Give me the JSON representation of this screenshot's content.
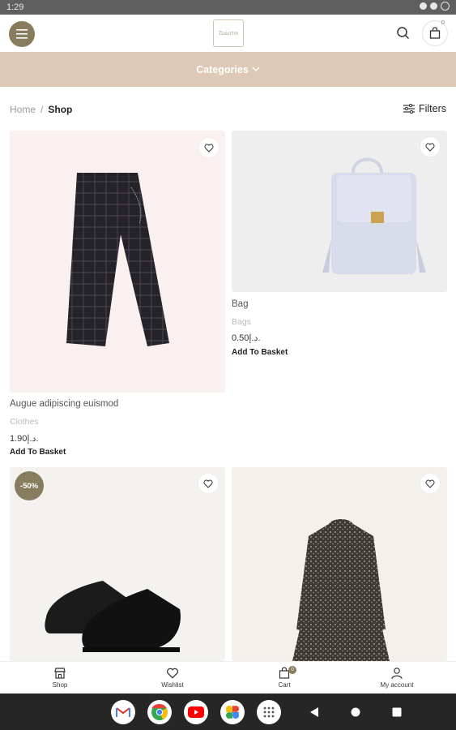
{
  "status_bar": {
    "time": "1:29"
  },
  "header": {
    "logo_text": "Tasarim",
    "cart_count": "0"
  },
  "categories": {
    "label": "Categories"
  },
  "breadcrumb": {
    "home": "Home",
    "separator": "/",
    "current": "Shop"
  },
  "filters": {
    "label": "Filters"
  },
  "products": [
    {
      "name": "Augue adipiscing euismod",
      "category": "Clothes",
      "price": "1.90د.إ.",
      "action": "Add To Basket",
      "image": "checkered-trousers",
      "bg": "#fbf0f0"
    },
    {
      "name": "Bag",
      "category": "Bags",
      "price": "0.50د.إ.",
      "action": "Add To Basket",
      "image": "lavender-backpack",
      "bg": "#eeeeee"
    },
    {
      "name": "",
      "category": "",
      "price": "",
      "action": "",
      "image": "black-sneakers",
      "bg": "#f3f2ee",
      "badge": "-50%"
    },
    {
      "name": "",
      "category": "",
      "price": "",
      "action": "",
      "image": "floral-dress",
      "bg": "#f4f0ec"
    }
  ],
  "bottom_nav": {
    "shop": "Shop",
    "wishlist": "Wishlist",
    "cart": "Cart",
    "cart_count": "0",
    "account": "My account"
  },
  "colors": {
    "accent": "#887c5f",
    "category_bar": "#ddc9b5"
  }
}
